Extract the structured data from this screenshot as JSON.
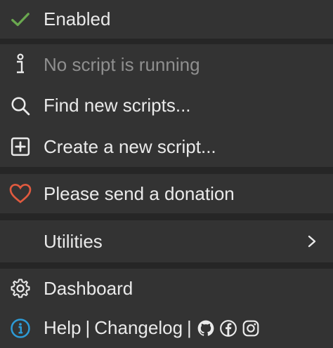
{
  "menu": {
    "enabled": {
      "label": "Enabled",
      "icon": "check-icon",
      "icon_color": "#6aa84f"
    },
    "status": {
      "label": "No script is running",
      "icon": "info-icon"
    },
    "find": {
      "label": "Find new scripts...",
      "icon": "search-icon"
    },
    "create": {
      "label": "Create a new script...",
      "icon": "plus-square-icon"
    },
    "donate": {
      "label": "Please send a donation",
      "icon": "heart-icon",
      "icon_color": "#e05a3f"
    },
    "utilities": {
      "label": "Utilities",
      "icon": "chevron-right-icon"
    },
    "dashboard": {
      "label": "Dashboard",
      "icon": "gear-icon"
    },
    "help": {
      "help_label": "Help",
      "separator": "|",
      "changelog_label": "Changelog",
      "separator2": "|",
      "icon": "info-circle-icon",
      "icon_color": "#2d9bd6",
      "social_icons": [
        "github-icon",
        "facebook-icon",
        "instagram-icon"
      ]
    }
  }
}
